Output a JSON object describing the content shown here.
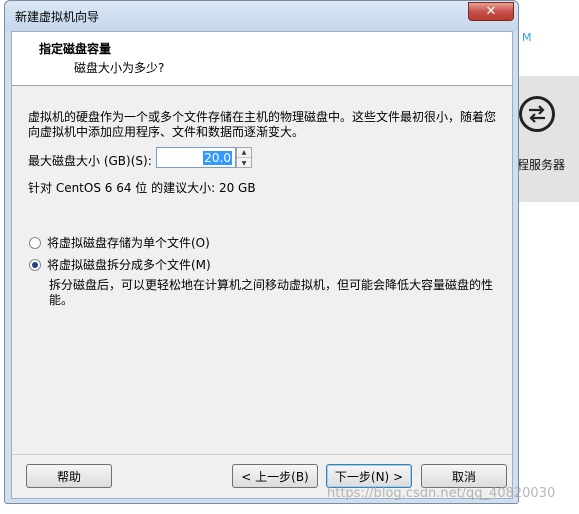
{
  "background": {
    "remote_server_label": "程服务器",
    "corner_letter": "M"
  },
  "window": {
    "title": "新建虚拟机向导",
    "close_label": "✕"
  },
  "header": {
    "title": "指定磁盘容量",
    "subtitle": "磁盘大小为多少?"
  },
  "content": {
    "description": "虚拟机的硬盘作为一个或多个文件存储在主机的物理磁盘中。这些文件最初很小，随着您向虚拟机中添加应用程序、文件和数据而逐渐变大。",
    "max_size_label": "最大磁盘大小 (GB)(S):",
    "max_size_value": "20.0",
    "recommended": "针对 CentOS 6 64 位 的建议大小: 20 GB",
    "option_single": "将虚拟磁盘存储为单个文件(O)",
    "option_split": "将虚拟磁盘拆分成多个文件(M)",
    "selected_option": "split",
    "split_description": "拆分磁盘后，可以更轻松地在计算机之间移动虚拟机，但可能会降低大容量磁盘的性能。"
  },
  "buttons": {
    "help": "帮助",
    "back": "< 上一步(B)",
    "next": "下一步(N) >",
    "cancel": "取消"
  },
  "watermark": "https://blog.csdn.net/qq_40820030"
}
